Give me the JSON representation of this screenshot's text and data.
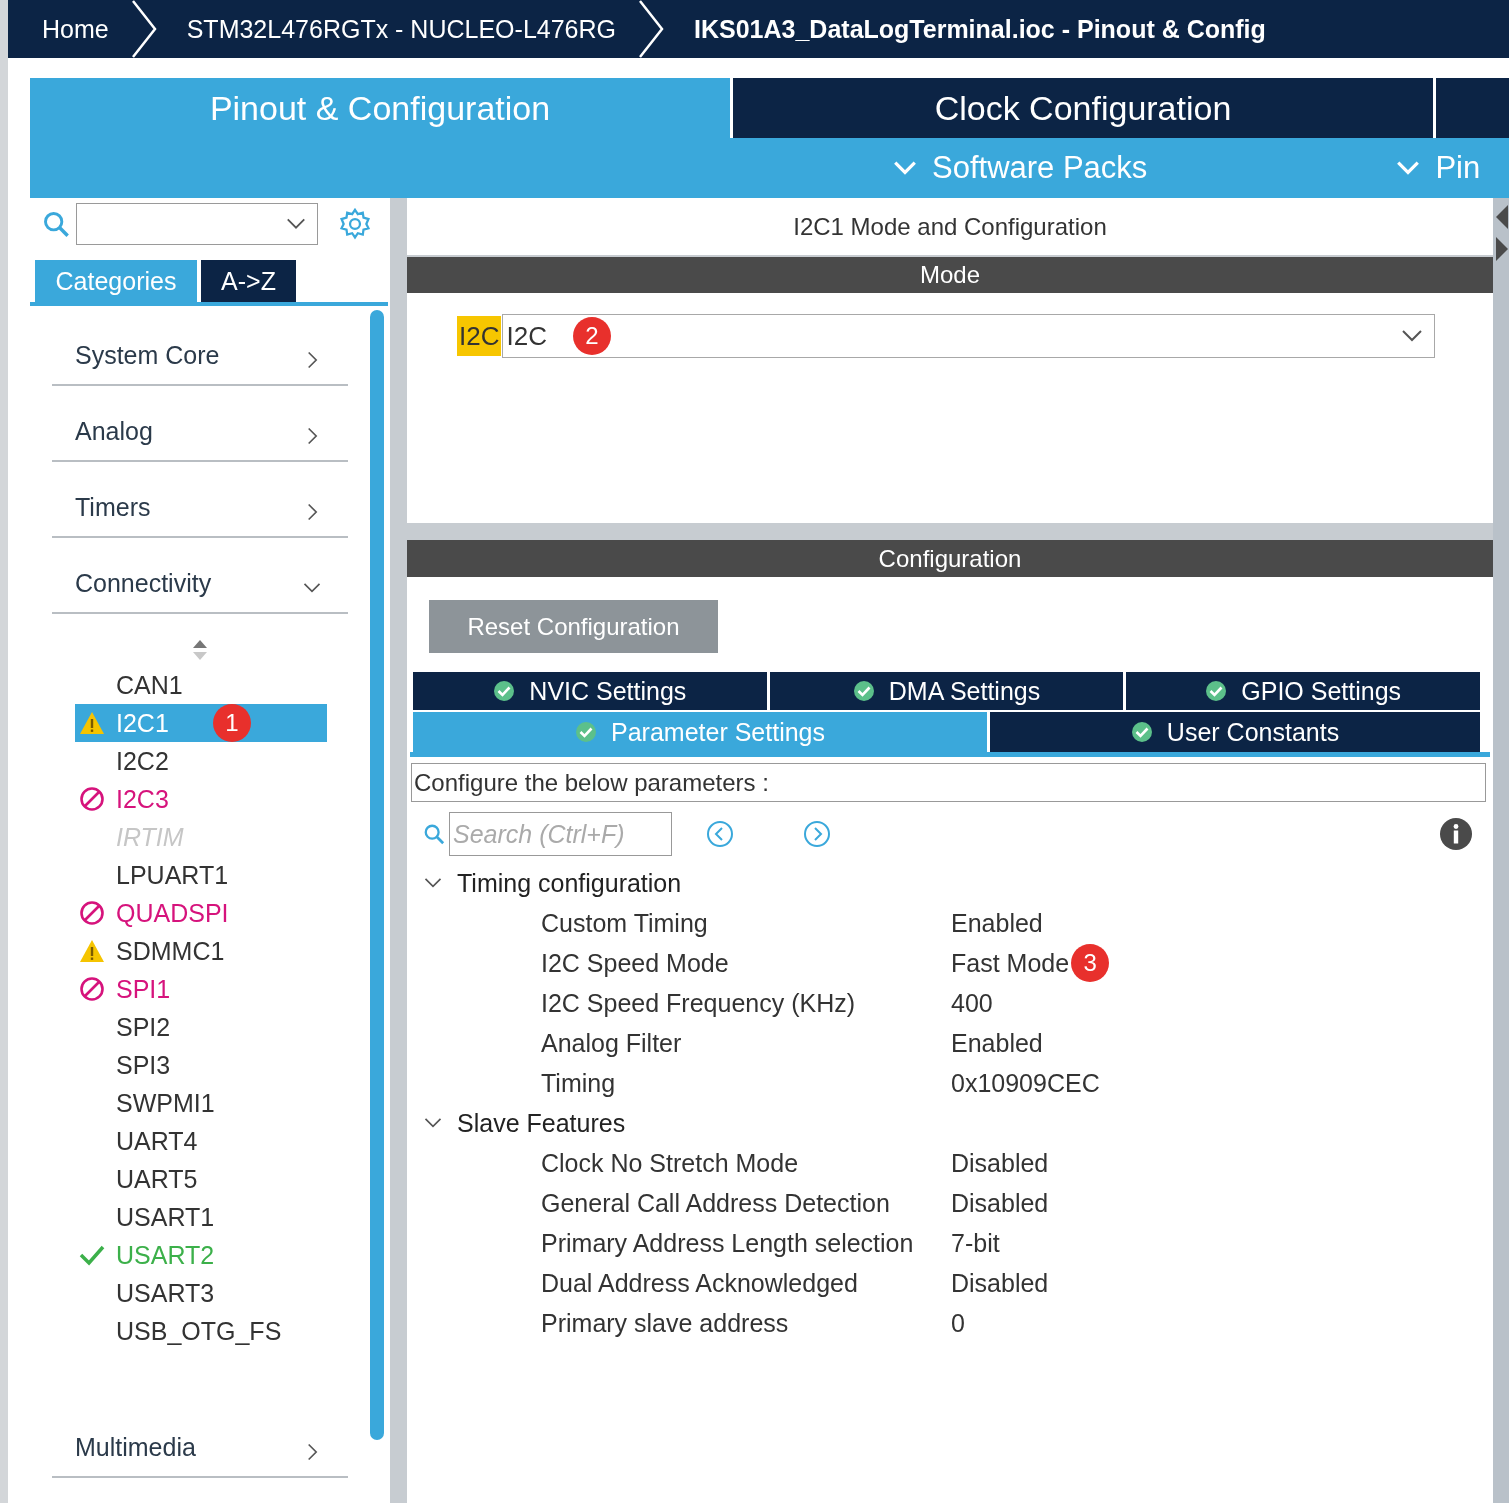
{
  "breadcrumb": [
    {
      "label": "Home",
      "selected": false
    },
    {
      "label": "STM32L476RGTx  -  NUCLEO-L476RG",
      "selected": false
    },
    {
      "label": "IKS01A3_DataLogTerminal.ioc - Pinout & Config",
      "selected": true
    }
  ],
  "main_tabs": [
    {
      "label": "Pinout & Configuration",
      "selected": true
    },
    {
      "label": "Clock Configuration",
      "selected": false
    },
    {
      "selected": false
    }
  ],
  "sub_menu": [
    "Software Packs",
    "Pin"
  ],
  "left": {
    "tabs": [
      {
        "label": "Categories",
        "selected": true
      },
      {
        "label": "A->Z",
        "selected": false
      }
    ],
    "categories": [
      {
        "label": "System Core",
        "expanded": false
      },
      {
        "label": "Analog",
        "expanded": false
      },
      {
        "label": "Timers",
        "expanded": false
      },
      {
        "label": "Connectivity",
        "expanded": true,
        "children": [
          {
            "label": "CAN1",
            "kind": "plain",
            "selected": false
          },
          {
            "label": "I2C1",
            "kind": "warning",
            "selected": true,
            "badge": "1"
          },
          {
            "label": "I2C2",
            "kind": "plain",
            "selected": false
          },
          {
            "label": "I2C3",
            "kind": "blocked",
            "selected": false
          },
          {
            "label": "IRTIM",
            "kind": "unavailable",
            "selected": false
          },
          {
            "label": "LPUART1",
            "kind": "plain",
            "selected": false
          },
          {
            "label": "QUADSPI",
            "kind": "blocked",
            "selected": false
          },
          {
            "label": "SDMMC1",
            "kind": "warning",
            "selected": false
          },
          {
            "label": "SPI1",
            "kind": "blocked",
            "selected": false
          },
          {
            "label": "SPI2",
            "kind": "plain",
            "selected": false
          },
          {
            "label": "SPI3",
            "kind": "plain",
            "selected": false
          },
          {
            "label": "SWPMI1",
            "kind": "plain",
            "selected": false
          },
          {
            "label": "UART4",
            "kind": "plain",
            "selected": false
          },
          {
            "label": "UART5",
            "kind": "plain",
            "selected": false
          },
          {
            "label": "USART1",
            "kind": "plain",
            "selected": false
          },
          {
            "label": "USART2",
            "kind": "ok",
            "selected": false
          },
          {
            "label": "USART3",
            "kind": "plain",
            "selected": false
          },
          {
            "label": "USB_OTG_FS",
            "kind": "plain",
            "selected": false
          }
        ]
      },
      {
        "label": "Multimedia",
        "expanded": false
      }
    ]
  },
  "right": {
    "title": "I2C1 Mode and Configuration",
    "mode_header": "Mode",
    "mode": {
      "tag": "I2C",
      "value": "I2C",
      "badge": "2"
    },
    "config_header": "Configuration",
    "reset_button": "Reset Configuration",
    "tab_rows": [
      [
        {
          "label": "NVIC Settings",
          "selected": false
        },
        {
          "label": "DMA Settings",
          "selected": false
        },
        {
          "label": "GPIO Settings",
          "selected": false
        }
      ],
      [
        {
          "label": "Parameter Settings",
          "selected": true
        },
        {
          "label": "User Constants",
          "selected": false
        }
      ]
    ],
    "description": "Configure the below parameters :",
    "search": {
      "placeholder": "Search (Ctrl+F)"
    },
    "groups": [
      {
        "label": "Timing configuration",
        "expanded": true,
        "params": [
          {
            "name": "Custom Timing",
            "value": "Enabled"
          },
          {
            "name": "I2C Speed Mode",
            "value": "Fast Mode",
            "badge": "3"
          },
          {
            "name": "I2C Speed Frequency (KHz)",
            "value": "400"
          },
          {
            "name": "Analog Filter",
            "value": "Enabled"
          },
          {
            "name": "Timing",
            "value": "0x10909CEC"
          }
        ]
      },
      {
        "label": "Slave Features",
        "expanded": true,
        "params": [
          {
            "name": "Clock No Stretch Mode",
            "value": "Disabled"
          },
          {
            "name": "General Call Address Detection",
            "value": "Disabled"
          },
          {
            "name": "Primary Address Length selection",
            "value": "7-bit"
          },
          {
            "name": "Dual Address Acknowledged",
            "value": "Disabled"
          },
          {
            "name": "Primary slave address",
            "value": "0"
          }
        ]
      }
    ]
  }
}
